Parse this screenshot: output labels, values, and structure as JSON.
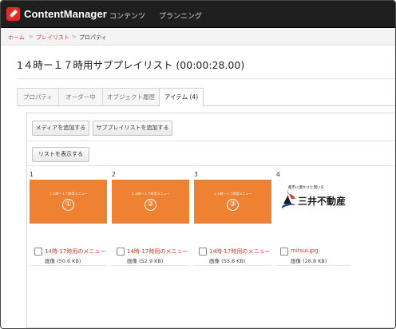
{
  "app": {
    "name": "ContentManager"
  },
  "nav": [
    "コンテンツ",
    "プランニング"
  ],
  "breadcrumb": {
    "home": "ホーム",
    "playlists": "プレイリスト",
    "current": "プロパティ",
    "sep": ">"
  },
  "page": {
    "title": "1４時ー１７時用サブプレイリスト (00:00:28.00)"
  },
  "tabs": [
    "プロパティ",
    "オーダー中",
    "オブジェクト履歴",
    "アイテム (4)"
  ],
  "actions": {
    "add_media": "メディアを追加する",
    "add_subplaylist": "サブプレイリストを追加する",
    "show_list": "リストを表示する"
  },
  "items": [
    {
      "index": "1",
      "thumb_title": "１４時ー１７時用メニュー",
      "thumb_mark": "①",
      "name": "14時-17時用のメニュー",
      "meta": "画像 (50.6 KB)"
    },
    {
      "index": "2",
      "thumb_title": "１４時ー１７時用メニュー",
      "thumb_mark": "②",
      "name": "14時-17時用のメニュー",
      "meta": "画像 (52.9 KB)"
    },
    {
      "index": "3",
      "thumb_title": "１４時ー１７時用メニュー",
      "thumb_mark": "③",
      "name": "14時-17時用のメニュー",
      "meta": "画像 (53.8 KB)"
    },
    {
      "index": "4",
      "logo_tagline": "都市に豊かさと潤いを",
      "logo_name": "三井不動産",
      "name": "mitsui.jpg",
      "meta": "画像 (28.8 KB)"
    }
  ],
  "colors": {
    "topbar": "#1f1f1f",
    "brand_red": "#e02b26",
    "link": "#d23b2e",
    "thumb_orange": "#ee8132",
    "mitsui_blue": "#1d3c8f"
  },
  "icons": {
    "logo": "pencil-icon",
    "checkbox": "checkbox-icon"
  }
}
